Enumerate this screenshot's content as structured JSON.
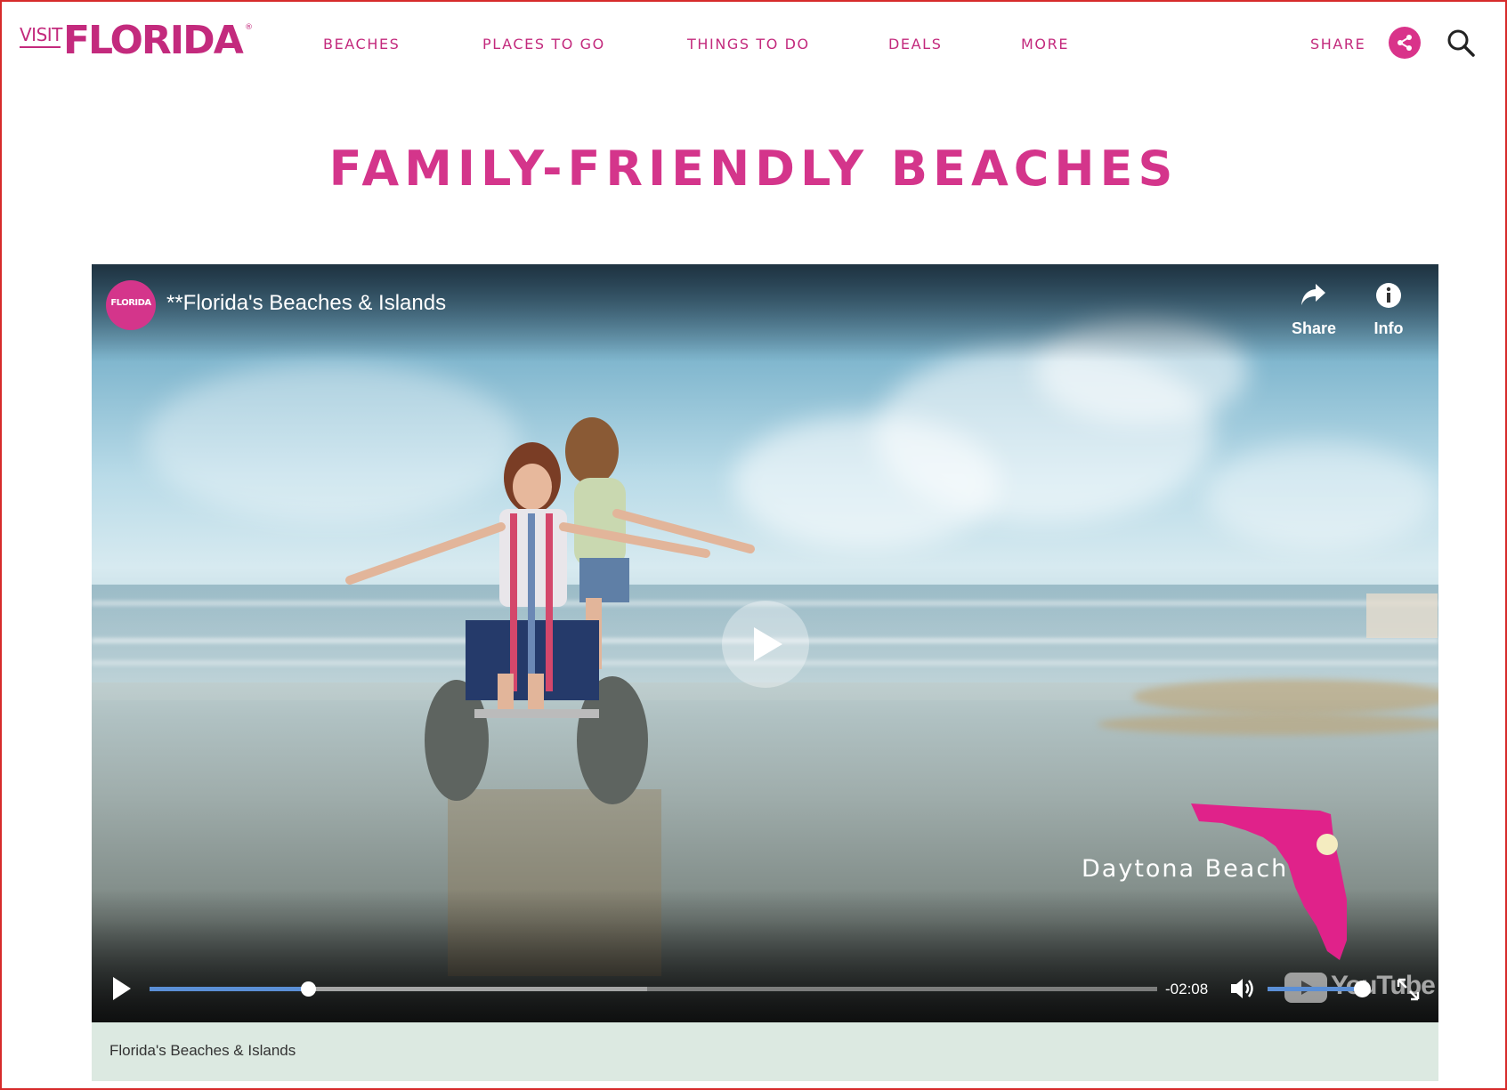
{
  "header": {
    "logo_visit": "VISIT",
    "logo_florida": "FLORIDA",
    "logo_reg": "®",
    "nav": [
      {
        "label": "BEACHES"
      },
      {
        "label": "PLACES TO GO"
      },
      {
        "label": "THINGS TO DO"
      },
      {
        "label": "DEALS"
      },
      {
        "label": "MORE"
      }
    ],
    "share_label": "SHARE",
    "share_icon": "share-icon",
    "search_icon": "search-icon"
  },
  "page": {
    "title": "FAMILY-FRIENDLY BEACHES"
  },
  "video": {
    "channel_avatar_text": "FLORIDA",
    "title": "**Florida's Beaches & Islands",
    "share_label": "Share",
    "info_label": "Info",
    "location_overlay": "Daytona Beach",
    "time_remaining": "-02:08",
    "progress": 0.157,
    "buffered": 0.494,
    "volume": 0.92,
    "youtube_text": "YouTube",
    "accent_color": "#5b8fd6",
    "map_color": "#e0228a"
  },
  "caption": {
    "text": "Florida's Beaches & Islands"
  },
  "colors": {
    "brand_pink": "#c32a7d",
    "title_pink": "#d4358b",
    "caption_bg": "#dce9e1"
  }
}
